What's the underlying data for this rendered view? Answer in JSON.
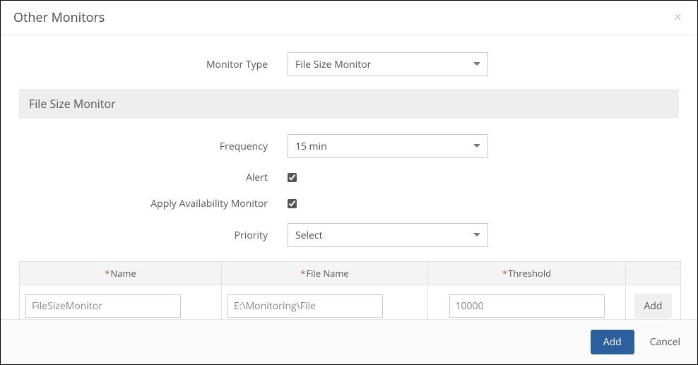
{
  "modal": {
    "title": "Other Monitors"
  },
  "form": {
    "monitor_type": {
      "label": "Monitor Type",
      "value": "File Size Monitor"
    },
    "section_title": "File Size Monitor",
    "frequency": {
      "label": "Frequency",
      "value": "15 min"
    },
    "alert": {
      "label": "Alert",
      "checked": true
    },
    "availability": {
      "label": "Apply Availability Monitor",
      "checked": true
    },
    "priority": {
      "label": "Priority",
      "value": "Select"
    }
  },
  "table": {
    "headers": {
      "name": "Name",
      "file": "File Name",
      "threshold": "Threshold"
    },
    "row": {
      "name_placeholder": "FileSizeMonitor",
      "file_placeholder": "E:\\Monitoring\\File",
      "threshold_placeholder": "10000",
      "name_value": "",
      "file_value": "",
      "threshold_value": ""
    },
    "add_label": "Add"
  },
  "footer": {
    "add": "Add",
    "cancel": "Cancel"
  }
}
